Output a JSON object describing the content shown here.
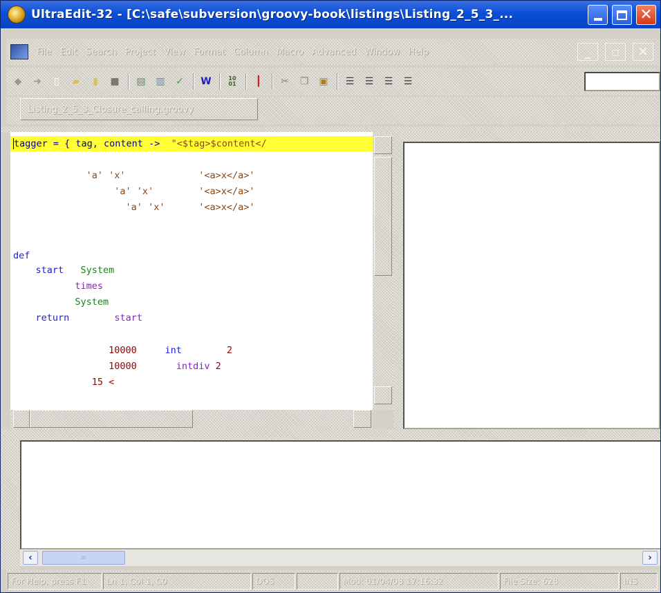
{
  "window": {
    "title": "UltraEdit-32 - [C:\\safe\\subversion\\groovy-book\\listings\\Listing_2_5_3_...",
    "accent_color": "#0842c4"
  },
  "menu": {
    "items": [
      "File",
      "Edit",
      "Search",
      "Project",
      "View",
      "Format",
      "Column",
      "Macro",
      "Advanced",
      "Window",
      "Help"
    ]
  },
  "toolbar": {
    "icons": [
      "back-icon",
      "forward-icon",
      "new-file-icon",
      "open-folder-icon",
      "open-file-icon",
      "save-icon",
      "print-icon",
      "print-preview-icon",
      "spell-check-icon",
      "word-wrap-icon",
      "hex-mode-icon",
      "column-marker-icon",
      "cut-icon",
      "copy-icon",
      "paste-icon",
      "align-left-icon",
      "align-center-icon",
      "align-right-icon",
      "justify-icon"
    ],
    "word_wrap_glyph": "W",
    "hex_glyph": "10\n01"
  },
  "file_tab": {
    "label": "Listing_2_5_3_Closure_calling.groovy"
  },
  "editor": {
    "lines": [
      {
        "segments": [
          {
            "text": "tagger = { tag, content ->  ",
            "class": "c-default"
          },
          {
            "text": "\"<$tag>$content</",
            "class": "c-str"
          }
        ]
      },
      {
        "segments": [
          {
            "text": "             'a' 'x'             '<a>x</a>'",
            "class": "c-str"
          }
        ]
      },
      {
        "segments": [
          {
            "text": "                  'a' 'x'        '<a>x</a>'",
            "class": "c-str"
          }
        ]
      },
      {
        "segments": [
          {
            "text": "                    'a' 'x'      '<a>x</a>'",
            "class": "c-str"
          }
        ]
      },
      {
        "segments": [
          {
            "text": "def",
            "class": "c-kw"
          }
        ]
      },
      {
        "segments": [
          {
            "text": "    start   ",
            "class": "c-kw"
          },
          {
            "text": "System",
            "class": "c-cls"
          }
        ]
      },
      {
        "segments": [
          {
            "text": "           times",
            "class": "c-meth"
          }
        ]
      },
      {
        "segments": [
          {
            "text": "           System",
            "class": "c-cls"
          }
        ]
      },
      {
        "segments": [
          {
            "text": "    return        ",
            "class": "c-kw"
          },
          {
            "text": "start",
            "class": "c-meth"
          }
        ]
      },
      {
        "segments": [
          {
            "text": "                 10000",
            "class": "c-num"
          },
          {
            "text": "     int        ",
            "class": "c-kw"
          },
          {
            "text": "2",
            "class": "c-num"
          }
        ]
      },
      {
        "segments": [
          {
            "text": "                 10000",
            "class": "c-num"
          },
          {
            "text": "       intdiv ",
            "class": "c-meth"
          },
          {
            "text": "2",
            "class": "c-num"
          }
        ]
      },
      {
        "segments": [
          {
            "text": "              15 <",
            "class": "c-num"
          }
        ]
      }
    ]
  },
  "status": {
    "cells": [
      "For Help, press F1",
      "Ln 1, Col 1, C0",
      "DOS",
      "",
      "Mod: 01/04/08 17:16:32",
      "File Size: 628",
      "INS"
    ]
  }
}
